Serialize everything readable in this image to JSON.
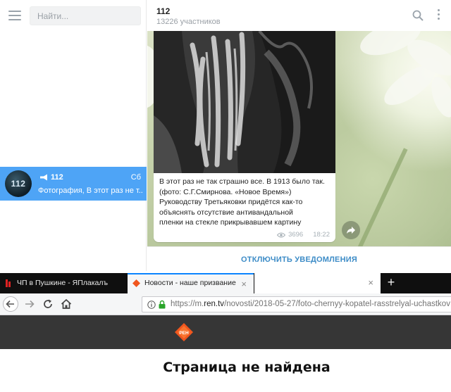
{
  "telegram": {
    "sidebar": {
      "search_placeholder": "Найти...",
      "chats": [
        {
          "avatar_text": "112",
          "name": "112",
          "day": "Сб",
          "preview": "Фотография, В этот раз не т..."
        }
      ]
    },
    "header": {
      "title": "112",
      "subtitle": "13226 участников"
    },
    "message": {
      "lines": [
        "В этот раз не так страшно все. В 1913 было так.",
        "(фото: С.Г.Смирнова. «Новое Время»)",
        "Руководству Третьяковки придётся как-то",
        "объяснять отсутствие антивандальной",
        "пленки на стекле прикрывавшем картину"
      ],
      "views": "3696",
      "time": "18:22"
    },
    "footer": {
      "action_label": "ОТКЛЮЧИТЬ УВЕДОМЛЕНИЯ"
    },
    "colors": {
      "accent": "#4ea4f6",
      "link": "#3d8cc7"
    },
    "icons": [
      "menu-icon",
      "search-icon",
      "more-icon",
      "channel-icon",
      "eye-icon",
      "share-icon"
    ]
  },
  "browser": {
    "tabs": [
      {
        "title": "ЧП в Пушкине - ЯПлакалъ",
        "active": false
      },
      {
        "title": "Новости - наше призвание. | Р",
        "active": true
      },
      {
        "title": "",
        "active": false
      }
    ],
    "new_tab_label": "+",
    "url": {
      "prefix": "https://m.",
      "host": "ren.tv",
      "path": "/novosti/2018-05-27/foto-chernyy-kopatel-rasstrelyal-uchastkov"
    },
    "page": {
      "heading": "Страница не найдена",
      "logo_text": "РЕН"
    },
    "colors": {
      "tab_accent": "#0a84ff",
      "site_header": "#363636",
      "logo": "#f0561e"
    }
  }
}
